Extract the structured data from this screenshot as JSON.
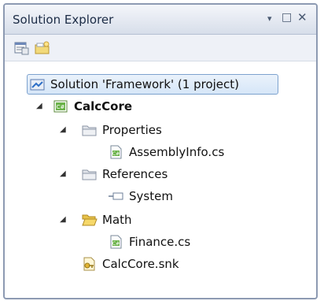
{
  "window": {
    "title": "Solution Explorer",
    "pin_glyph": "▾",
    "maximize_glyph": "□",
    "close_glyph": "✕"
  },
  "toolbar": {
    "items": [
      {
        "icon": "properties-icon"
      },
      {
        "icon": "new-folder-icon"
      }
    ]
  },
  "tree": {
    "solution": {
      "label": "Solution 'Framework' (1 project)",
      "icon": "solution-icon",
      "selected": true
    },
    "project": {
      "label": "CalcCore",
      "icon": "csharp-project-icon",
      "expanded": true
    },
    "items": [
      {
        "label": "Properties",
        "icon": "folder-icon",
        "expanded": true
      },
      {
        "label": "AssemblyInfo.cs",
        "icon": "csharp-file-icon"
      },
      {
        "label": "References",
        "icon": "folder-icon",
        "expanded": true
      },
      {
        "label": "System",
        "icon": "reference-icon"
      },
      {
        "label": "Math",
        "icon": "folder-open-icon",
        "expanded": true
      },
      {
        "label": "Finance.cs",
        "icon": "csharp-file-icon"
      },
      {
        "label": "CalcCore.snk",
        "icon": "key-file-icon"
      }
    ]
  },
  "colors": {
    "selection_border": "#7da2ce",
    "titlebar_top": "#f4f6fa",
    "titlebar_bottom": "#d7deea"
  }
}
